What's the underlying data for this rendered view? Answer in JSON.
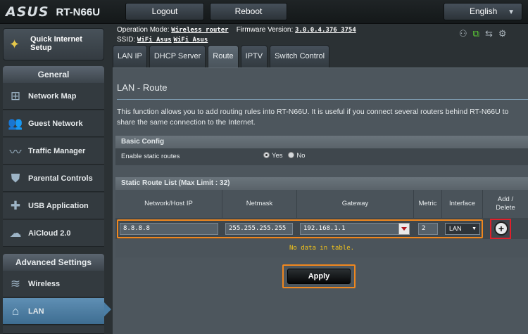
{
  "brand": {
    "logo": "ASUS",
    "model": "RT-N66U"
  },
  "topbar": {
    "logout": "Logout",
    "reboot": "Reboot",
    "language": "English"
  },
  "sidebar": {
    "quick_setup": "Quick Internet Setup",
    "general_title": "General",
    "general_items": [
      {
        "label": "Network Map",
        "icon": "network-map-icon"
      },
      {
        "label": "Guest Network",
        "icon": "guest-network-icon"
      },
      {
        "label": "Traffic Manager",
        "icon": "traffic-manager-icon"
      },
      {
        "label": "Parental Controls",
        "icon": "parental-controls-icon"
      },
      {
        "label": "USB Application",
        "icon": "usb-application-icon"
      },
      {
        "label": "AiCloud 2.0",
        "icon": "aicloud-icon"
      }
    ],
    "advanced_title": "Advanced Settings",
    "advanced_items": [
      {
        "label": "Wireless",
        "icon": "wireless-icon"
      },
      {
        "label": "LAN",
        "icon": "lan-icon",
        "active": true
      }
    ]
  },
  "info": {
    "operation_mode_label": "Operation Mode:",
    "operation_mode": "Wireless router",
    "firmware_label": "Firmware Version:",
    "firmware": "3.0.0.4.376_3754",
    "ssid_label": "SSID:",
    "ssid_1": "WiFi_Asus",
    "ssid_2": "WiFi_Asus"
  },
  "tabs": [
    "LAN IP",
    "DHCP Server",
    "Route",
    "IPTV",
    "Switch Control"
  ],
  "active_tab": "Route",
  "page": {
    "title": "LAN - Route",
    "description": "This function allows you to add routing rules into RT-N66U. It is useful if you connect several routers behind RT-N66U to share the same connection to the Internet."
  },
  "basic_config": {
    "header": "Basic Config",
    "enable_label": "Enable static routes",
    "yes": "Yes",
    "no": "No",
    "selected": "Yes"
  },
  "route_list": {
    "header": "Static Route List (Max Limit : 32)",
    "columns": [
      "Network/Host IP",
      "Netmask",
      "Gateway",
      "Metric",
      "Interface",
      "Add / Delete"
    ],
    "input": {
      "ip": "8.8.8.8",
      "netmask": "255.255.255.255",
      "gateway": "192.168.1.1",
      "metric": "2",
      "interface": "LAN"
    },
    "empty_message": "No data in table."
  },
  "apply_label": "Apply",
  "colors": {
    "highlight": "#f0871e",
    "add_highlight": "#e0202b",
    "nav_active": "#4b7ea5",
    "empty_text": "#f2c31b"
  }
}
